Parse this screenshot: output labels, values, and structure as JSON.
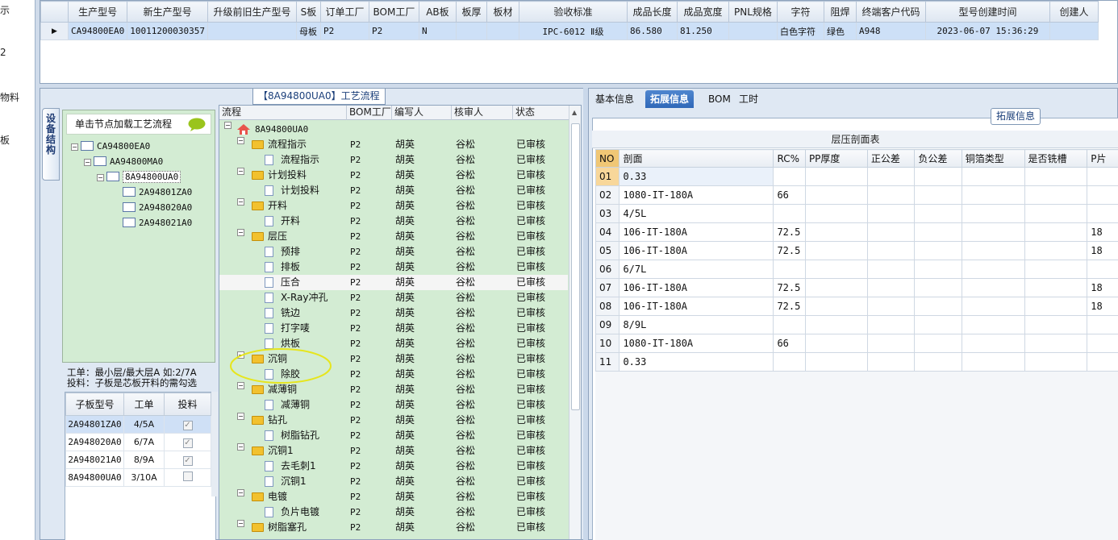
{
  "left_strip": {
    "items": [
      "示",
      "2",
      "物料",
      "板"
    ]
  },
  "top_grid": {
    "headers": [
      "生产型号",
      "新生产型号",
      "升级前旧生产型号",
      "S板",
      "订单工厂",
      "BOM工厂",
      "AB板",
      "板厚",
      "板材",
      "验收标准",
      "成品长度",
      "成品宽度",
      "PNL规格",
      "字符",
      "阻焊",
      "终端客户代码",
      "型号创建时间",
      "创建人"
    ],
    "row": [
      "CA94800EA0",
      "10011200030357",
      "",
      "母板",
      "P2",
      "P2",
      "N",
      "",
      "",
      "IPC-6012 Ⅱ级",
      "86.580",
      "81.250",
      "",
      "白色字符",
      "绿色",
      "A948",
      "2023-06-07 15:36:29",
      ""
    ]
  },
  "process_panel": {
    "title": "【8A94800UA0】工艺流程",
    "side_tab": "设备结构"
  },
  "tree": {
    "hint": "单击节点加载工艺流程",
    "nodes": [
      "CA94800EA0",
      "AA94800MA0",
      "8A94800UA0",
      "2A94801ZA0",
      "2A948020A0",
      "2A948021A0"
    ]
  },
  "notes": {
    "line1": "工单：最小层/最大层A 如:2/7A",
    "line2": "投料：子板是芯板开料的需勾选"
  },
  "sub_table": {
    "headers": [
      "子板型号",
      "工单",
      "投料"
    ],
    "rows": [
      {
        "model": "2A94801ZA0",
        "work": "4/5A",
        "feed": "✓"
      },
      {
        "model": "2A948020A0",
        "work": "6/7A",
        "feed": "✓"
      },
      {
        "model": "2A948021A0",
        "work": "8/9A",
        "feed": "✓"
      },
      {
        "model": "8A94800UA0",
        "work": "3/10A",
        "feed": ""
      }
    ]
  },
  "process_grid": {
    "headers": [
      "流程",
      "BOM工厂",
      "编写人",
      "核审人",
      "状态"
    ],
    "root": "8A94800UA0",
    "rows": [
      {
        "kind": "folder",
        "name": "流程指示",
        "fact": "P2",
        "writer": "胡英",
        "rev": "谷松",
        "status": "已审核"
      },
      {
        "kind": "item",
        "name": "流程指示",
        "fact": "P2",
        "writer": "胡英",
        "rev": "谷松",
        "status": "已审核"
      },
      {
        "kind": "folder",
        "name": "计划投料",
        "fact": "P2",
        "writer": "胡英",
        "rev": "谷松",
        "status": "已审核"
      },
      {
        "kind": "item",
        "name": "计划投料",
        "fact": "P2",
        "writer": "胡英",
        "rev": "谷松",
        "status": "已审核"
      },
      {
        "kind": "folder",
        "name": "开料",
        "fact": "P2",
        "writer": "胡英",
        "rev": "谷松",
        "status": "已审核"
      },
      {
        "kind": "item",
        "name": "开料",
        "fact": "P2",
        "writer": "胡英",
        "rev": "谷松",
        "status": "已审核"
      },
      {
        "kind": "folder",
        "name": "层压",
        "fact": "P2",
        "writer": "胡英",
        "rev": "谷松",
        "status": "已审核"
      },
      {
        "kind": "item",
        "name": "预排",
        "fact": "P2",
        "writer": "胡英",
        "rev": "谷松",
        "status": "已审核"
      },
      {
        "kind": "item",
        "name": "排板",
        "fact": "P2",
        "writer": "胡英",
        "rev": "谷松",
        "status": "已审核"
      },
      {
        "kind": "item",
        "name": "压合",
        "fact": "P2",
        "writer": "胡英",
        "rev": "谷松",
        "status": "已审核",
        "hl": true
      },
      {
        "kind": "item",
        "name": "X-Ray冲孔",
        "fact": "P2",
        "writer": "胡英",
        "rev": "谷松",
        "status": "已审核"
      },
      {
        "kind": "item",
        "name": "铣边",
        "fact": "P2",
        "writer": "胡英",
        "rev": "谷松",
        "status": "已审核"
      },
      {
        "kind": "item",
        "name": "打字唛",
        "fact": "P2",
        "writer": "胡英",
        "rev": "谷松",
        "status": "已审核"
      },
      {
        "kind": "item",
        "name": "烘板",
        "fact": "P2",
        "writer": "胡英",
        "rev": "谷松",
        "status": "已审核"
      },
      {
        "kind": "folder",
        "name": "沉铜",
        "fact": "P2",
        "writer": "胡英",
        "rev": "谷松",
        "status": "已审核"
      },
      {
        "kind": "item",
        "name": "除胶",
        "fact": "P2",
        "writer": "胡英",
        "rev": "谷松",
        "status": "已审核"
      },
      {
        "kind": "folder",
        "name": "减薄铜",
        "fact": "P2",
        "writer": "胡英",
        "rev": "谷松",
        "status": "已审核"
      },
      {
        "kind": "item",
        "name": "减薄铜",
        "fact": "P2",
        "writer": "胡英",
        "rev": "谷松",
        "status": "已审核"
      },
      {
        "kind": "folder",
        "name": "钻孔",
        "fact": "P2",
        "writer": "胡英",
        "rev": "谷松",
        "status": "已审核"
      },
      {
        "kind": "item",
        "name": "树脂钻孔",
        "fact": "P2",
        "writer": "胡英",
        "rev": "谷松",
        "status": "已审核"
      },
      {
        "kind": "folder",
        "name": "沉铜1",
        "fact": "P2",
        "writer": "胡英",
        "rev": "谷松",
        "status": "已审核"
      },
      {
        "kind": "item",
        "name": "去毛刺1",
        "fact": "P2",
        "writer": "胡英",
        "rev": "谷松",
        "status": "已审核"
      },
      {
        "kind": "item",
        "name": "沉铜1",
        "fact": "P2",
        "writer": "胡英",
        "rev": "谷松",
        "status": "已审核"
      },
      {
        "kind": "folder",
        "name": "电镀",
        "fact": "P2",
        "writer": "胡英",
        "rev": "谷松",
        "status": "已审核"
      },
      {
        "kind": "item",
        "name": "负片电镀",
        "fact": "P2",
        "writer": "胡英",
        "rev": "谷松",
        "status": "已审核"
      },
      {
        "kind": "folder",
        "name": "树脂塞孔",
        "fact": "P2",
        "writer": "胡英",
        "rev": "谷松",
        "status": "已审核"
      }
    ]
  },
  "right_panel": {
    "tabs": [
      "基本信息",
      "拓展信息",
      "BOM",
      "工时"
    ],
    "active_tab": "拓展信息",
    "group_label": "拓展信息",
    "table_title": "层压剖面表",
    "headers": [
      "NO",
      "剖面",
      "RC%",
      "PP厚度",
      "正公差",
      "负公差",
      "铜箔类型",
      "是否铣槽",
      "P片"
    ],
    "rows": [
      [
        "01",
        "0.33",
        "",
        "",
        "",
        "",
        "",
        "",
        ""
      ],
      [
        "02",
        "1080-IT-180A",
        "66",
        "",
        "",
        "",
        "",
        "",
        ""
      ],
      [
        "03",
        "4/5L",
        "",
        "",
        "",
        "",
        "",
        "",
        ""
      ],
      [
        "04",
        "106-IT-180A",
        "72.5",
        "",
        "",
        "",
        "",
        "",
        "18"
      ],
      [
        "05",
        "106-IT-180A",
        "72.5",
        "",
        "",
        "",
        "",
        "",
        "18"
      ],
      [
        "06",
        "6/7L",
        "",
        "",
        "",
        "",
        "",
        "",
        ""
      ],
      [
        "07",
        "106-IT-180A",
        "72.5",
        "",
        "",
        "",
        "",
        "",
        "18"
      ],
      [
        "08",
        "106-IT-180A",
        "72.5",
        "",
        "",
        "",
        "",
        "",
        "18"
      ],
      [
        "09",
        "8/9L",
        "",
        "",
        "",
        "",
        "",
        "",
        ""
      ],
      [
        "10",
        "1080-IT-180A",
        "66",
        "",
        "",
        "",
        "",
        "",
        ""
      ],
      [
        "11",
        "0.33",
        "",
        "",
        "",
        "",
        "",
        "",
        ""
      ]
    ]
  },
  "colors": {
    "green_bg": "#d3ecd3",
    "selected_blue": "#cde0f7",
    "tab_active": "#2f68b8",
    "annotation_yellow": "#e6e51d",
    "folder": "#f2c12e"
  }
}
